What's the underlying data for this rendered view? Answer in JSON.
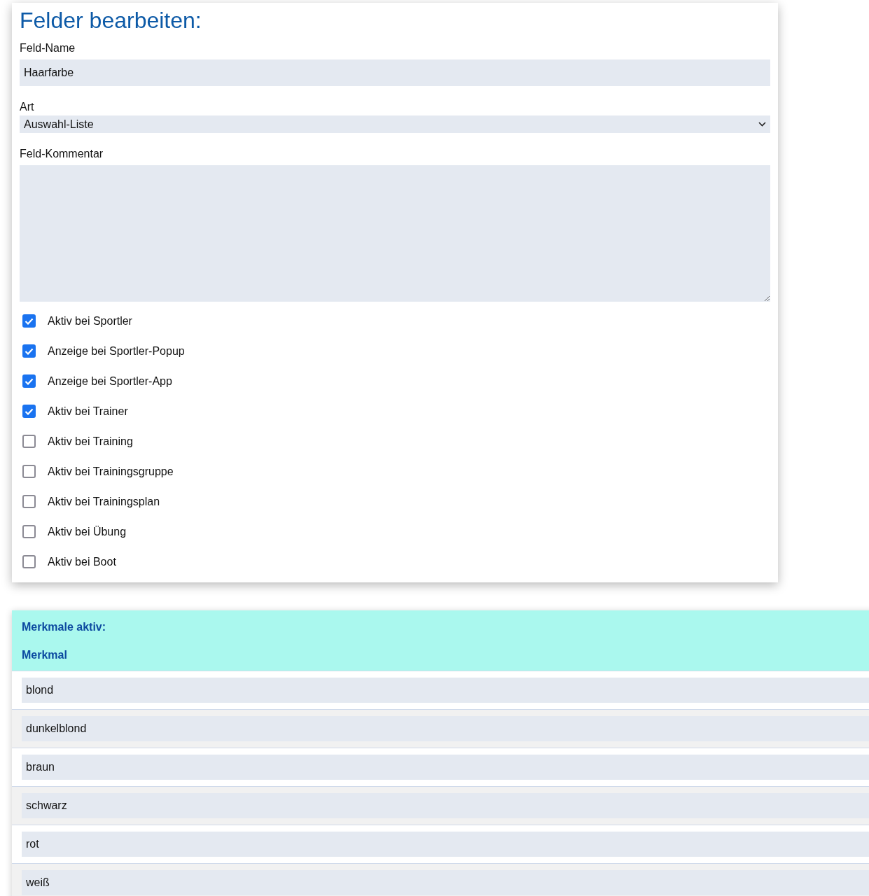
{
  "form": {
    "title": "Felder bearbeiten:",
    "name_field": {
      "label": "Feld-Name",
      "value": "Haarfarbe"
    },
    "type_field": {
      "label": "Art",
      "value": "Auswahl-Liste"
    },
    "comment_field": {
      "label": "Feld-Kommentar"
    },
    "options": [
      {
        "label": "Aktiv bei Sportler",
        "checked": true
      },
      {
        "label": "Anzeige bei Sportler-Popup",
        "checked": true
      },
      {
        "label": "Anzeige bei Sportler-App",
        "checked": true
      },
      {
        "label": "Aktiv bei Trainer",
        "checked": true
      },
      {
        "label": "Aktiv bei Training",
        "checked": false
      },
      {
        "label": "Aktiv bei Trainingsgruppe",
        "checked": false
      },
      {
        "label": "Aktiv bei Trainingsplan",
        "checked": false
      },
      {
        "label": "Aktiv bei Übung",
        "checked": false
      },
      {
        "label": "Aktiv bei Boot",
        "checked": false
      }
    ]
  },
  "table": {
    "title": "Merkmale aktiv:",
    "columns": [
      "Merkmal"
    ],
    "rows": [
      {
        "value": "blond"
      },
      {
        "value": "dunkelblond"
      },
      {
        "value": "braun"
      },
      {
        "value": "schwarz"
      },
      {
        "value": "rot"
      },
      {
        "value": "weiß"
      }
    ]
  }
}
